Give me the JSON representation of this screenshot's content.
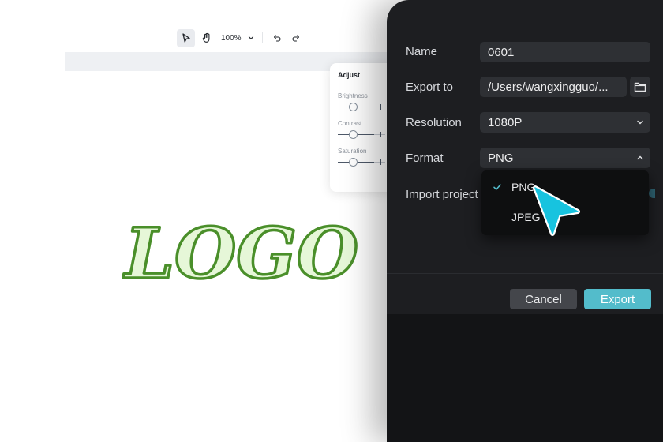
{
  "toolbar": {
    "zoom_value": "100%"
  },
  "adjust_panel": {
    "title": "Adjust",
    "sliders": [
      {
        "label": "Brightness"
      },
      {
        "label": "Contrast"
      },
      {
        "label": "Saturation"
      }
    ]
  },
  "canvas": {
    "logo_text": "LOGO",
    "logo_fill": "#e6f7d8",
    "logo_stroke": "#4a8f2a"
  },
  "export_dialog": {
    "name_label": "Name",
    "name_value": "0601",
    "export_to_label": "Export to",
    "export_to_value": "/Users/wangxingguo/...",
    "resolution_label": "Resolution",
    "resolution_value": "1080P",
    "format_label": "Format",
    "format_value": "PNG",
    "import_label": "Import project",
    "format_options": [
      {
        "label": "PNG",
        "selected": true
      },
      {
        "label": "JPEG",
        "selected": false
      }
    ],
    "cancel_label": "Cancel",
    "export_label": "Export",
    "accent_color": "#53bccb"
  }
}
